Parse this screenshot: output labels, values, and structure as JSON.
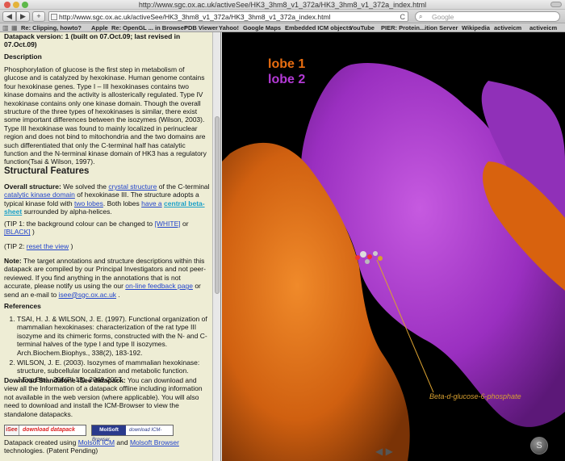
{
  "window": {
    "title": "http://www.sgc.ox.ac.uk/activeSee/HK3_3hm8_v1_372a/HK3_3hm8_v1_372a_index.html"
  },
  "toolbar": {
    "back_label": "◀",
    "forward_label": "▶",
    "add_label": "+",
    "url": "http://www.sgc.ox.ac.uk/activeSee/HK3_3hm8_v1_372a/HK3_3hm8_v1_372a_index.html",
    "refresh_label": "C",
    "search_placeholder": "Google"
  },
  "bookmarks": [
    "Re: Clipping, howto?",
    "Apple",
    "Re: OpenGL ... in Browser",
    "PDB Viewer",
    "Yahoo!",
    "Google Maps",
    "Embedded ICM objects",
    "YouTube",
    "PIER: Protein...ition Server",
    "Wikipedia",
    "activeicm",
    "activeicm"
  ],
  "content": {
    "version": "Datapack version: 1 (built on 07.Oct.09; last revised in 07.Oct.09)",
    "description_heading": "Description",
    "description": "Phosphorylation of glucose is the first step in metabolism of glucose and is catalyzed by hexokinase. Human genome contains four hexokinase genes. Type I – III hexokinases contains two kinase domains and the activity is allosterically regulated. Type IV hexokinase contains only one kinase domain. Though the overall structure of the three types of hexokinases is similar, there exist some important differences between the isozymes (Wilson, 2003). Type III hexokinase was found to mainly localized in perinuclear region and does not bind to mitochondria and the two domains are such differentiated that only the C-terminal half has catalytic function and the N-terminal kinase domain of HK3 has a regulatory function(Tsai & Wilson, 1997).",
    "structural_heading": "Structural Features",
    "overall_label": "Overall structure:",
    "overall_1": "We solved the",
    "link_crystal": "crystal structure",
    "overall_2": "of the C-terminal",
    "link_catalytic": "catalytic kinase domain",
    "overall_3": "of hexokinase III. The structure adopts a typical kinase fold with",
    "link_two_lobes": "two lobes",
    "overall_4": ". Both lobes",
    "link_have_a": "have a",
    "link_sheet": "central beta-sheet",
    "overall_5": "surrounded by alpha-helices.",
    "tip1_1": "(TIP 1: the background colour can be changed to",
    "link_white": "[WHITE]",
    "tip1_2": "or",
    "link_black": "[BLACK]",
    "tip1_3": ")",
    "tip2_1": "(TIP 2:",
    "link_reset": "reset the view",
    "tip2_2": ")",
    "note_label": "Note:",
    "note_1": "The target annotations and structure descriptions within this datapack are compiled by our Principal Investigators and not peer-reviewed. If you find anything in the annotations that is not accurate, please notify us using the our",
    "link_feedback": "on-line feedback page",
    "note_2": "or send an e-mail to",
    "link_email": "isee@sgc.ox.ac.uk",
    "note_3": ".",
    "references_heading": "References",
    "references": [
      "TSAI, H. J. & WILSON, J. E. (1997). Functional organization of mammalian hexokinases: characterization of the rat type III isozyme and its chimeric forms, constructed with the N- and C-terminal halves of the type I and type II isozymes. Arch.Biochem.Biophys., 338(2), 183-192.",
      "WILSON, J. E. (2003). Isozymes of mammalian hexokinase: structure, subcellular localization and metabolic function. J.Exp.Biol., 206(Pt 12), 2049-2057."
    ],
    "download_label": "Download Standalone iSee datapack:",
    "download_text": "You can download and view all the Information of a datapack offline including information not available in the web version (where applicable). You will also need to download and install the ICM-Browser to view the standalone datapacks.",
    "btn_datapack_icon": "iSee",
    "btn_datapack": "download datapack",
    "btn_browser_icon": "MolSoft",
    "btn_browser": "download ICM-Browser",
    "created_1": "Datapack created using",
    "link_icm": "Molsoft ICM",
    "created_2": "and",
    "link_browser": "Molsoft Browser",
    "created_3": "technologies. (Patent Pending)"
  },
  "viewer": {
    "lobe1": "lobe 1",
    "lobe2": "lobe 2",
    "ligand": "Beta-d-glucose-6-phosphate",
    "arrows": "◀ ▶",
    "orbit": "S",
    "colors": {
      "lobe1": "#e86d10",
      "lobe2": "#b43ad6"
    }
  }
}
